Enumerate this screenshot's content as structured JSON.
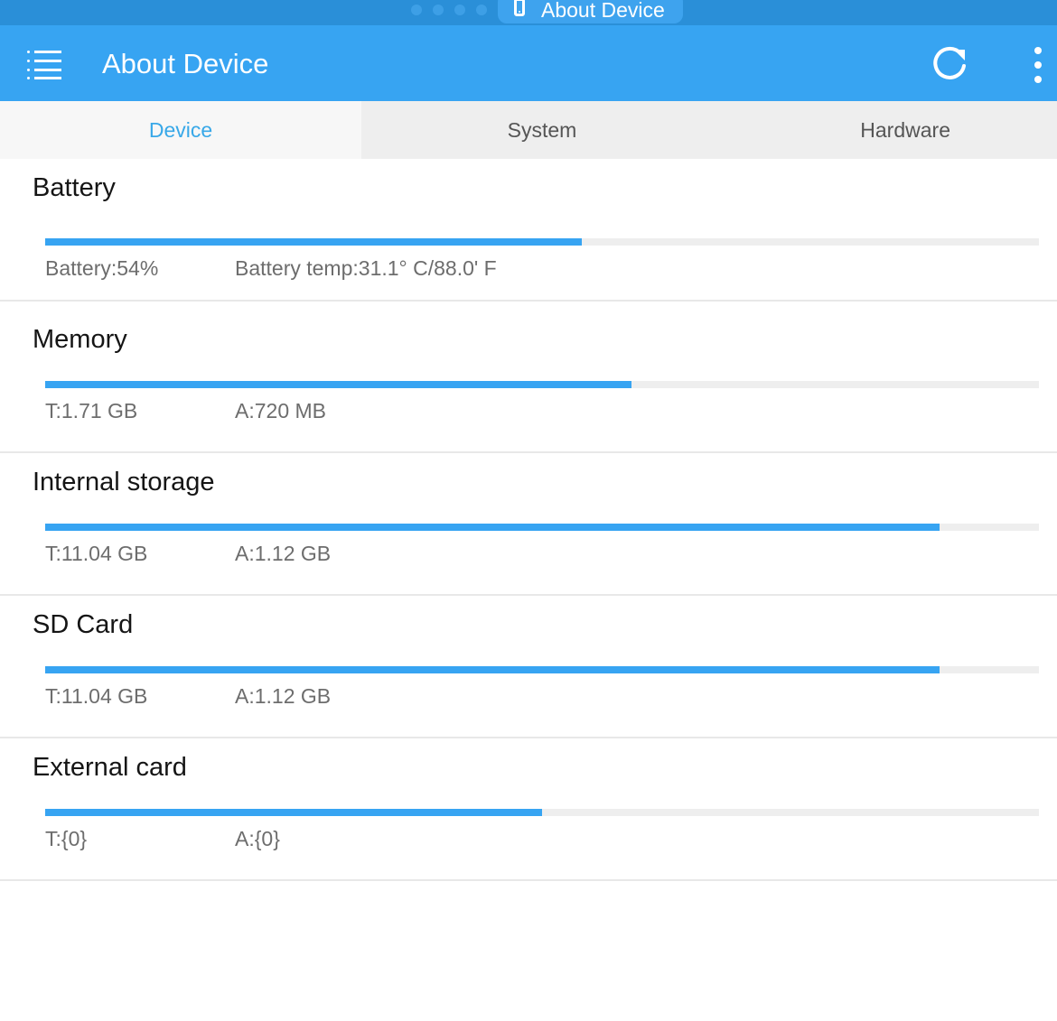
{
  "status_strip": {
    "pill_label": "About Device",
    "page_dots": 4
  },
  "app_bar": {
    "title": "About Device",
    "icons": [
      "menu-icon",
      "refresh-icon",
      "more-vert-icon"
    ]
  },
  "colors": {
    "accent": "#37a4f2",
    "strip": "#2a8fd8",
    "active_tab_text": "#38a8e8",
    "track": "#eeeeee"
  },
  "tabs": [
    {
      "label": "Device",
      "active": true
    },
    {
      "label": "System",
      "active": false
    },
    {
      "label": "Hardware",
      "active": false
    }
  ],
  "sections": [
    {
      "title": "Battery",
      "left": "Battery:54%",
      "right": "Battery temp:31.1° C/88.0' F",
      "progress": 0.54
    },
    {
      "title": "Memory",
      "left": "T:1.71 GB",
      "right": "A:720 MB",
      "progress": 0.59
    },
    {
      "title": "Internal storage",
      "left": "T:11.04 GB",
      "right": "A:1.12 GB",
      "progress": 0.9
    },
    {
      "title": "SD Card",
      "left": "T:11.04 GB",
      "right": "A:1.12 GB",
      "progress": 0.9
    },
    {
      "title": "External card",
      "left": "T:{0}",
      "right": "A:{0}",
      "progress": 0.5
    }
  ]
}
